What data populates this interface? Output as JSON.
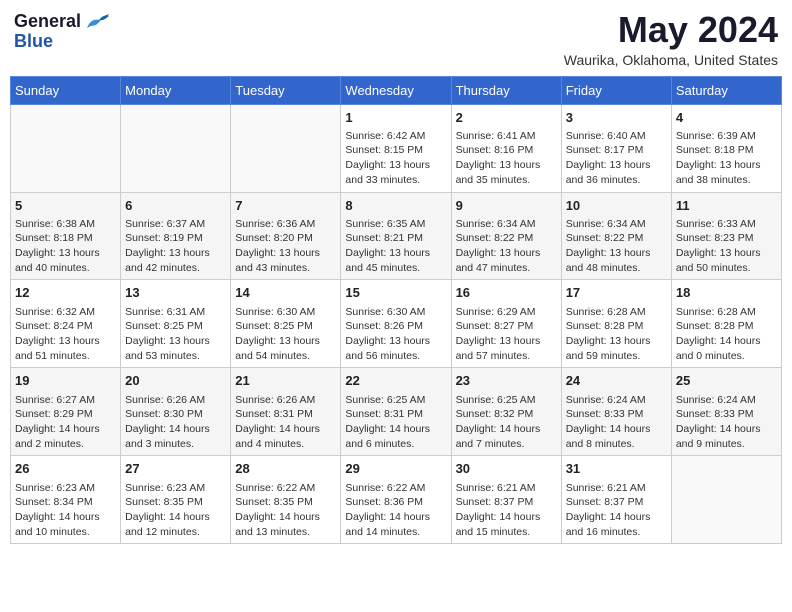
{
  "header": {
    "logo_general": "General",
    "logo_blue": "Blue",
    "title": "May 2024",
    "location": "Waurika, Oklahoma, United States"
  },
  "calendar": {
    "days_of_week": [
      "Sunday",
      "Monday",
      "Tuesday",
      "Wednesday",
      "Thursday",
      "Friday",
      "Saturday"
    ],
    "weeks": [
      [
        {
          "day": "",
          "info": ""
        },
        {
          "day": "",
          "info": ""
        },
        {
          "day": "",
          "info": ""
        },
        {
          "day": "1",
          "info": "Sunrise: 6:42 AM\nSunset: 8:15 PM\nDaylight: 13 hours and 33 minutes."
        },
        {
          "day": "2",
          "info": "Sunrise: 6:41 AM\nSunset: 8:16 PM\nDaylight: 13 hours and 35 minutes."
        },
        {
          "day": "3",
          "info": "Sunrise: 6:40 AM\nSunset: 8:17 PM\nDaylight: 13 hours and 36 minutes."
        },
        {
          "day": "4",
          "info": "Sunrise: 6:39 AM\nSunset: 8:18 PM\nDaylight: 13 hours and 38 minutes."
        }
      ],
      [
        {
          "day": "5",
          "info": "Sunrise: 6:38 AM\nSunset: 8:18 PM\nDaylight: 13 hours and 40 minutes."
        },
        {
          "day": "6",
          "info": "Sunrise: 6:37 AM\nSunset: 8:19 PM\nDaylight: 13 hours and 42 minutes."
        },
        {
          "day": "7",
          "info": "Sunrise: 6:36 AM\nSunset: 8:20 PM\nDaylight: 13 hours and 43 minutes."
        },
        {
          "day": "8",
          "info": "Sunrise: 6:35 AM\nSunset: 8:21 PM\nDaylight: 13 hours and 45 minutes."
        },
        {
          "day": "9",
          "info": "Sunrise: 6:34 AM\nSunset: 8:22 PM\nDaylight: 13 hours and 47 minutes."
        },
        {
          "day": "10",
          "info": "Sunrise: 6:34 AM\nSunset: 8:22 PM\nDaylight: 13 hours and 48 minutes."
        },
        {
          "day": "11",
          "info": "Sunrise: 6:33 AM\nSunset: 8:23 PM\nDaylight: 13 hours and 50 minutes."
        }
      ],
      [
        {
          "day": "12",
          "info": "Sunrise: 6:32 AM\nSunset: 8:24 PM\nDaylight: 13 hours and 51 minutes."
        },
        {
          "day": "13",
          "info": "Sunrise: 6:31 AM\nSunset: 8:25 PM\nDaylight: 13 hours and 53 minutes."
        },
        {
          "day": "14",
          "info": "Sunrise: 6:30 AM\nSunset: 8:25 PM\nDaylight: 13 hours and 54 minutes."
        },
        {
          "day": "15",
          "info": "Sunrise: 6:30 AM\nSunset: 8:26 PM\nDaylight: 13 hours and 56 minutes."
        },
        {
          "day": "16",
          "info": "Sunrise: 6:29 AM\nSunset: 8:27 PM\nDaylight: 13 hours and 57 minutes."
        },
        {
          "day": "17",
          "info": "Sunrise: 6:28 AM\nSunset: 8:28 PM\nDaylight: 13 hours and 59 minutes."
        },
        {
          "day": "18",
          "info": "Sunrise: 6:28 AM\nSunset: 8:28 PM\nDaylight: 14 hours and 0 minutes."
        }
      ],
      [
        {
          "day": "19",
          "info": "Sunrise: 6:27 AM\nSunset: 8:29 PM\nDaylight: 14 hours and 2 minutes."
        },
        {
          "day": "20",
          "info": "Sunrise: 6:26 AM\nSunset: 8:30 PM\nDaylight: 14 hours and 3 minutes."
        },
        {
          "day": "21",
          "info": "Sunrise: 6:26 AM\nSunset: 8:31 PM\nDaylight: 14 hours and 4 minutes."
        },
        {
          "day": "22",
          "info": "Sunrise: 6:25 AM\nSunset: 8:31 PM\nDaylight: 14 hours and 6 minutes."
        },
        {
          "day": "23",
          "info": "Sunrise: 6:25 AM\nSunset: 8:32 PM\nDaylight: 14 hours and 7 minutes."
        },
        {
          "day": "24",
          "info": "Sunrise: 6:24 AM\nSunset: 8:33 PM\nDaylight: 14 hours and 8 minutes."
        },
        {
          "day": "25",
          "info": "Sunrise: 6:24 AM\nSunset: 8:33 PM\nDaylight: 14 hours and 9 minutes."
        }
      ],
      [
        {
          "day": "26",
          "info": "Sunrise: 6:23 AM\nSunset: 8:34 PM\nDaylight: 14 hours and 10 minutes."
        },
        {
          "day": "27",
          "info": "Sunrise: 6:23 AM\nSunset: 8:35 PM\nDaylight: 14 hours and 12 minutes."
        },
        {
          "day": "28",
          "info": "Sunrise: 6:22 AM\nSunset: 8:35 PM\nDaylight: 14 hours and 13 minutes."
        },
        {
          "day": "29",
          "info": "Sunrise: 6:22 AM\nSunset: 8:36 PM\nDaylight: 14 hours and 14 minutes."
        },
        {
          "day": "30",
          "info": "Sunrise: 6:21 AM\nSunset: 8:37 PM\nDaylight: 14 hours and 15 minutes."
        },
        {
          "day": "31",
          "info": "Sunrise: 6:21 AM\nSunset: 8:37 PM\nDaylight: 14 hours and 16 minutes."
        },
        {
          "day": "",
          "info": ""
        }
      ]
    ]
  }
}
